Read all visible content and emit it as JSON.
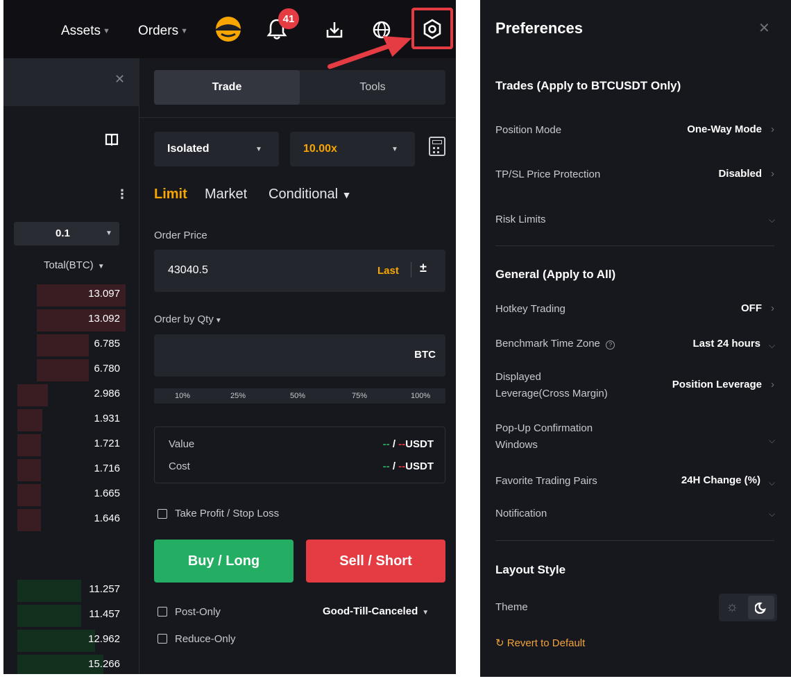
{
  "header": {
    "assets_label": "Assets",
    "orders_label": "Orders",
    "notification_count": "41"
  },
  "orderbook": {
    "precision": "0.1",
    "total_header": "Total(BTC)",
    "asks": [
      "13.097",
      "13.092",
      "6.785",
      "6.780",
      "2.986",
      "1.931",
      "1.721",
      "1.716",
      "1.665",
      "1.646"
    ],
    "bids": [
      "11.257",
      "11.457",
      "12.962",
      "15.266"
    ],
    "colors": {
      "ask_bar": "#3a1d22",
      "bid_bar": "#13301f"
    }
  },
  "trade": {
    "tabs": [
      "Trade",
      "Tools"
    ],
    "margin_mode": "Isolated",
    "leverage": "10.00x",
    "order_types": [
      "Limit",
      "Market",
      "Conditional"
    ],
    "order_price_label": "Order Price",
    "order_price_value": "43040.5",
    "last_label": "Last",
    "qty_label": "Order by Qty",
    "qty_unit": "BTC",
    "percentages": [
      "10%",
      "25%",
      "50%",
      "75%",
      "100%"
    ],
    "value_label": "Value",
    "cost_label": "Cost",
    "dash": "--",
    "slash": "/",
    "unit": "USDT",
    "tpsl_label": "Take Profit / Stop Loss",
    "buy_label": "Buy / Long",
    "sell_label": "Sell / Short",
    "post_only_label": "Post-Only",
    "reduce_only_label": "Reduce-Only",
    "time_in_force": "Good-Till-Canceled",
    "colors": {
      "accent": "#f7a600",
      "buy": "#24ae64",
      "sell": "#e53b43"
    }
  },
  "preferences": {
    "title": "Preferences",
    "sections": {
      "trades": "Trades (Apply to BTCUSDT Only)",
      "general": "General (Apply to All)",
      "layout": "Layout Style"
    },
    "rows": {
      "position_mode": {
        "label": "Position Mode",
        "value": "One-Way Mode"
      },
      "tpsl_protection": {
        "label": "TP/SL Price Protection",
        "value": "Disabled"
      },
      "risk_limits": {
        "label": "Risk Limits"
      },
      "hotkey": {
        "label": "Hotkey Trading",
        "value": "OFF"
      },
      "timezone": {
        "label": "Benchmark Time Zone",
        "value": "Last 24 hours"
      },
      "displayed_leverage": {
        "label_line1": "Displayed",
        "label_line2": "Leverage(Cross Margin)",
        "value": "Position Leverage"
      },
      "popup": {
        "label_line1": "Pop-Up Confirmation",
        "label_line2": "Windows"
      },
      "favorite_pairs": {
        "label": "Favorite Trading Pairs",
        "value": "24H Change (%)"
      },
      "notification": {
        "label": "Notification"
      },
      "theme": {
        "label": "Theme"
      }
    },
    "revert_label": "Revert to Default"
  }
}
